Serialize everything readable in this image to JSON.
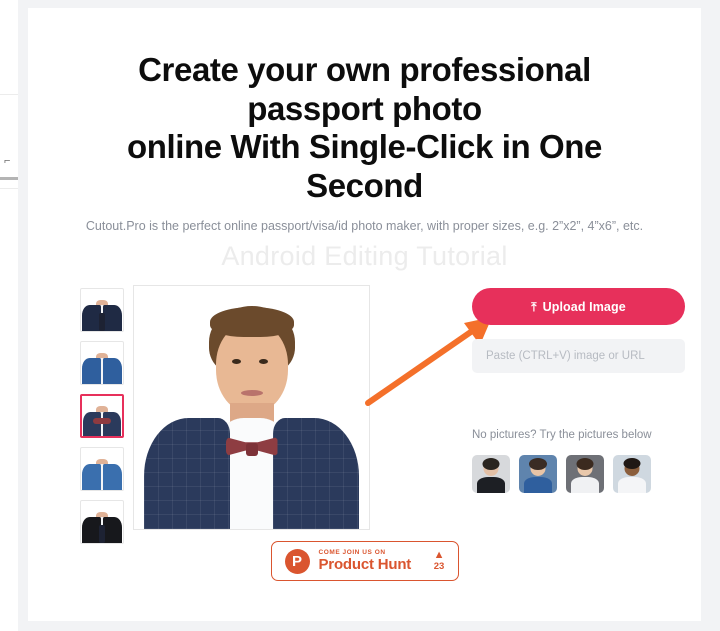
{
  "page": {
    "headline_lines": [
      "Create your own professional",
      "passport photo",
      "online With Single-Click in One",
      "Second"
    ],
    "subheadline": "Cutout.Pro is the perfect online passport/visa/id photo maker, with proper sizes, e.g. 2”x2”, 4”x6”, etc.",
    "watermark": "Android Editing Tutorial"
  },
  "colors": {
    "accent": "#E7305B",
    "product_hunt": "#DA552F",
    "annotation_arrow": "#F4702A",
    "page_background": "#F2F3F5",
    "card_background": "#FFFFFF",
    "muted_text": "#8A8F99"
  },
  "editor": {
    "outfit_thumbnails": [
      {
        "name": "navy-suit-black-tie",
        "selected": false,
        "jacket": "#1f2a44",
        "accessory": "tie"
      },
      {
        "name": "blue-suit-open-collar",
        "selected": false,
        "jacket": "#2f5f9e",
        "accessory": "none"
      },
      {
        "name": "navy-suit-bow-tie",
        "selected": true,
        "jacket": "#2b3a5c",
        "accessory": "bow"
      },
      {
        "name": "blue-suit-open-collar-2",
        "selected": false,
        "jacket": "#3a6fae",
        "accessory": "none"
      },
      {
        "name": "black-suit-black-tie",
        "selected": false,
        "jacket": "#17181c",
        "accessory": "tie"
      }
    ],
    "preview_alt": "Man in navy checked suit with white shirt and maroon bow tie on white background"
  },
  "upload": {
    "button_label": "Upload Image",
    "button_icon": "upload-icon",
    "paste_placeholder": "Paste (CTRL+V) image or URL",
    "paste_value": ""
  },
  "samples": {
    "prompt": "No pictures? Try the pictures below",
    "items": [
      {
        "name": "sample-woman-black-blazer",
        "background": "#d7d9dc",
        "skin": "#e3c0a6",
        "hair": "#2a2520",
        "clothing": "#1d1f24"
      },
      {
        "name": "sample-girl-blue-shirt",
        "background": "#5f84ad",
        "skin": "#e8c4a6",
        "hair": "#3a2c24",
        "clothing": "#2f5f9e"
      },
      {
        "name": "sample-child-white-top",
        "background": "#6e7076",
        "skin": "#e9c8ab",
        "hair": "#3b2a1f",
        "clothing": "#f0f1f3"
      },
      {
        "name": "sample-boy-white-uniform",
        "background": "#cfd8e0",
        "skin": "#8b5e3c",
        "hair": "#201814",
        "clothing": "#f4f5f7"
      }
    ]
  },
  "product_hunt": {
    "kicker": "COME JOIN US ON",
    "name": "Product Hunt",
    "logo_letter": "P",
    "upvote_caret": "▲",
    "upvote_count": "23"
  },
  "left_sliver": {
    "glyph": "⌐"
  }
}
